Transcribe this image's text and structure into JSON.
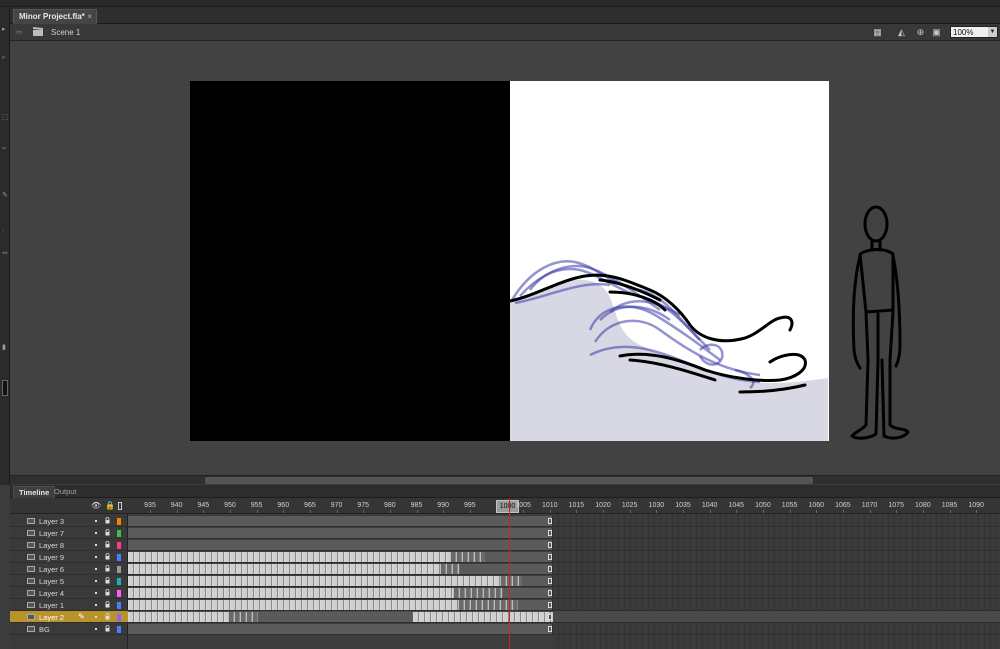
{
  "document": {
    "tab_label": "Minor Project.fla*",
    "close_glyph": "×"
  },
  "scene": {
    "label": "Scene 1",
    "zoom": "100%"
  },
  "panel_tabs": {
    "timeline": "Timeline",
    "output": "Output"
  },
  "timeline": {
    "current_frame": "1000",
    "frame_labels": [
      "935",
      "940",
      "945",
      "950",
      "955",
      "960",
      "965",
      "970",
      "975",
      "980",
      "985",
      "990",
      "995",
      "1005",
      "1010",
      "1015",
      "1020",
      "1025",
      "1030",
      "1035",
      "1040",
      "1045",
      "1050",
      "1055",
      "1060",
      "1065",
      "1070",
      "1075",
      "1080",
      "1085",
      "1090"
    ],
    "layers": [
      {
        "name": "Layer 3",
        "color": "#ff7f00",
        "active": false
      },
      {
        "name": "Layer 7",
        "color": "#3cbf3c",
        "active": false
      },
      {
        "name": "Layer 8",
        "color": "#ff3c8a",
        "active": false
      },
      {
        "name": "Layer 9",
        "color": "#4a7cff",
        "active": false
      },
      {
        "name": "Layer 6",
        "color": "#999999",
        "active": false
      },
      {
        "name": "Layer 5",
        "color": "#17b3b3",
        "active": false
      },
      {
        "name": "Layer 4",
        "color": "#ff5cff",
        "active": false
      },
      {
        "name": "Layer 1",
        "color": "#4a7cff",
        "active": false
      },
      {
        "name": "Layer 2",
        "color": "#9a5cff",
        "active": true
      },
      {
        "name": "BG",
        "color": "#4a7cff",
        "active": false
      }
    ]
  },
  "colors": {
    "stage_white": "#ffffff",
    "stage_black": "#000000",
    "wave_fill": "#d8d8e4",
    "onion_skin": "#3b3ba8",
    "active_layer": "#b8932c",
    "playhead": "#d42020"
  }
}
